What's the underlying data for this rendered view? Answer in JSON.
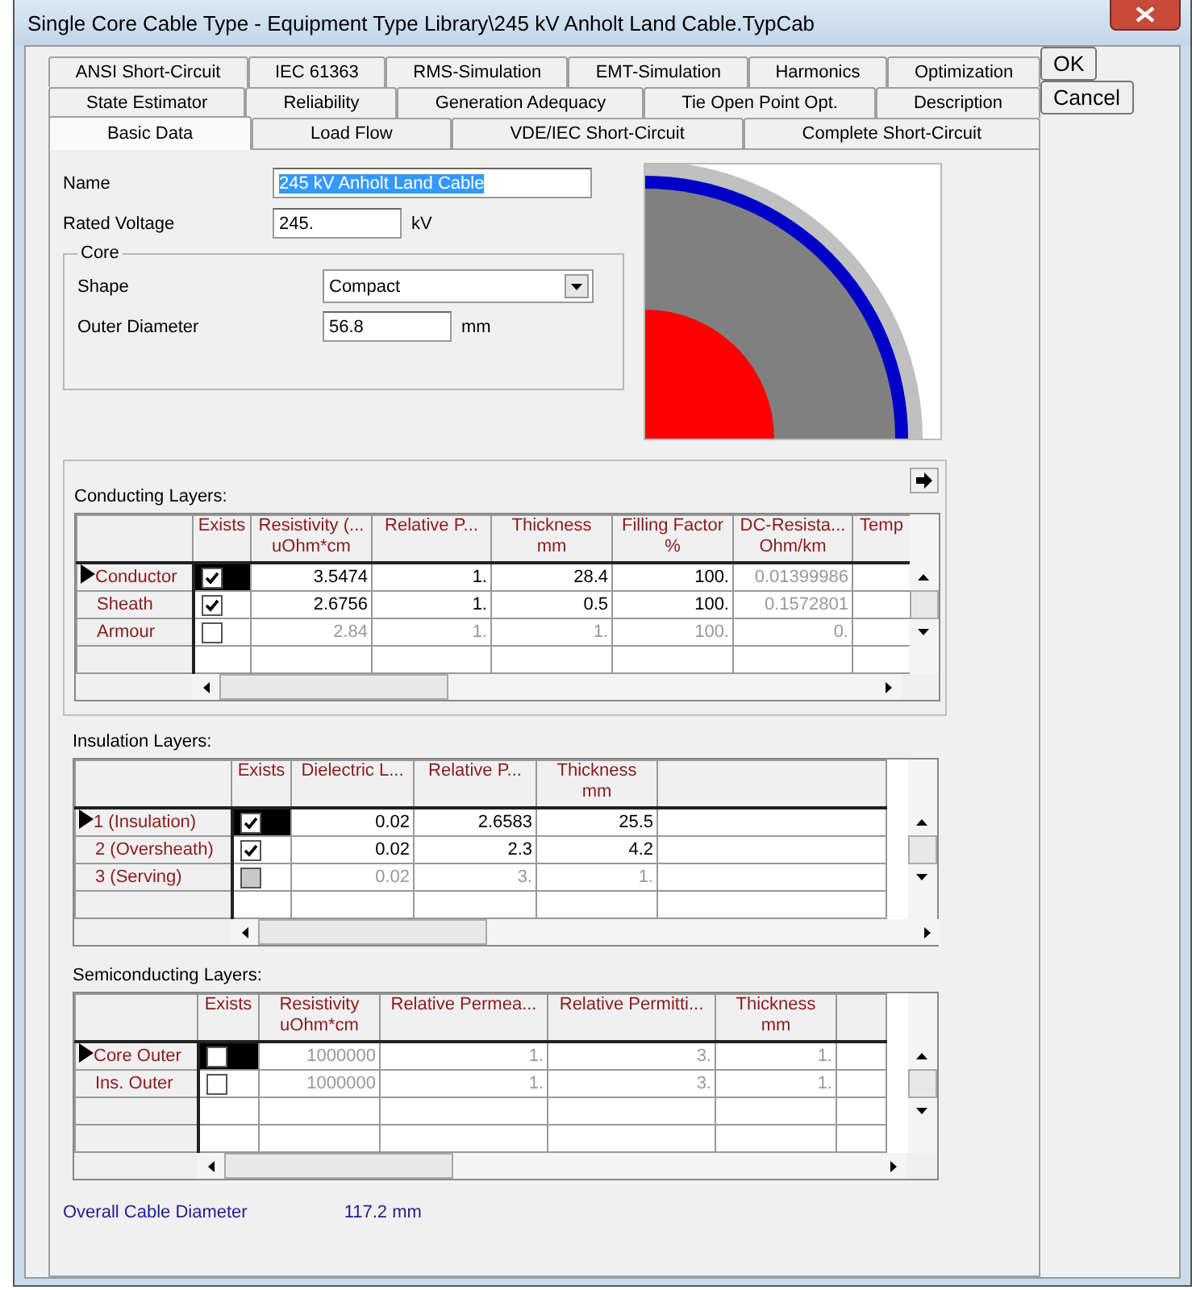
{
  "window": {
    "title": "Single Core Cable Type - Equipment Type Library\\245 kV Anholt Land Cable.TypCab"
  },
  "tab_rows": [
    [
      {
        "label": "ANSI Short-Circuit",
        "selected": false
      },
      {
        "label": "IEC 61363",
        "selected": false
      },
      {
        "label": "RMS-Simulation",
        "selected": false
      },
      {
        "label": "EMT-Simulation",
        "selected": false
      },
      {
        "label": "Harmonics",
        "selected": false
      },
      {
        "label": "Optimization",
        "selected": false
      }
    ],
    [
      {
        "label": "State Estimator",
        "selected": false
      },
      {
        "label": "Reliability",
        "selected": false
      },
      {
        "label": "Generation Adequacy",
        "selected": false
      },
      {
        "label": "Tie Open Point Opt.",
        "selected": false
      },
      {
        "label": "Description",
        "selected": false
      }
    ],
    [
      {
        "label": "Basic Data",
        "selected": true
      },
      {
        "label": "Load Flow",
        "selected": false
      },
      {
        "label": "VDE/IEC Short-Circuit",
        "selected": false
      },
      {
        "label": "Complete Short-Circuit",
        "selected": false
      }
    ]
  ],
  "buttons": [
    "OK",
    "Cancel"
  ],
  "name": {
    "label": "Name",
    "value": "245 kV Anholt Land Cable"
  },
  "rated_voltage": {
    "label": "Rated Voltage",
    "value": "245.",
    "unit": "kV"
  },
  "core": {
    "title": "Core",
    "shape_label": "Shape",
    "shape": "Compact",
    "diameter_label": "Outer Diameter",
    "diameter": "56.8",
    "unit": "mm"
  },
  "grids": [
    {
      "title": "Conducting Layers:",
      "exists_header": "Exists",
      "columns": [
        {
          "title": "Resistivity (...",
          "unit": "uOhm*cm"
        },
        {
          "title": "Relative P..."
        },
        {
          "title": "Thickness",
          "unit": "mm"
        },
        {
          "title": "Filling Factor",
          "unit": "%"
        },
        {
          "title": "DC-Resista...",
          "unit": "Ohm/km",
          "computed": true
        },
        {
          "title": "Temp"
        }
      ],
      "rows": [
        {
          "label": "Conductor",
          "selected": true,
          "exists": true,
          "disabled": false,
          "cells": [
            "3.5474",
            "1.",
            "28.4",
            "100.",
            "0.01399986"
          ]
        },
        {
          "label": "Sheath",
          "selected": false,
          "exists": true,
          "disabled": false,
          "cells": [
            "2.6756",
            "1.",
            "0.5",
            "100.",
            "0.1572801"
          ]
        },
        {
          "label": "Armour",
          "selected": false,
          "exists": false,
          "disabled": false,
          "cells": [
            "2.84",
            "1.",
            "1.",
            "100.",
            "0."
          ]
        }
      ]
    },
    {
      "title": "Insulation Layers:",
      "exists_header": "Exists",
      "columns": [
        {
          "title": "Dielectric L..."
        },
        {
          "title": "Relative P..."
        },
        {
          "title": "Thickness",
          "unit": "mm"
        }
      ],
      "rows": [
        {
          "label": "1 (Insulation)",
          "selected": true,
          "exists": true,
          "disabled": false,
          "cells": [
            "0.02",
            "2.6583",
            "25.5"
          ]
        },
        {
          "label": "2 (Oversheath)",
          "selected": false,
          "exists": true,
          "disabled": false,
          "cells": [
            "0.02",
            "2.3",
            "4.2"
          ]
        },
        {
          "label": "3 (Serving)",
          "selected": false,
          "exists": false,
          "disabled": true,
          "cells": [
            "0.02",
            "3.",
            "1."
          ]
        }
      ]
    },
    {
      "title": "Semiconducting Layers:",
      "exists_header": "Exists",
      "columns": [
        {
          "title": "Resistivity",
          "unit": "uOhm*cm"
        },
        {
          "title": "Relative Permea..."
        },
        {
          "title": "Relative Permitti..."
        },
        {
          "title": "Thickness",
          "unit": "mm"
        }
      ],
      "rows": [
        {
          "label": "Core Outer",
          "selected": true,
          "exists": false,
          "disabled": false,
          "cells": [
            "1000000",
            "1.",
            "3.",
            "1."
          ]
        },
        {
          "label": "Ins. Outer",
          "selected": false,
          "exists": false,
          "disabled": false,
          "cells": [
            "1000000",
            "1.",
            "3.",
            "1."
          ]
        }
      ]
    }
  ],
  "overall": {
    "label": "Overall Cable Diameter",
    "value": "117.2 mm"
  }
}
